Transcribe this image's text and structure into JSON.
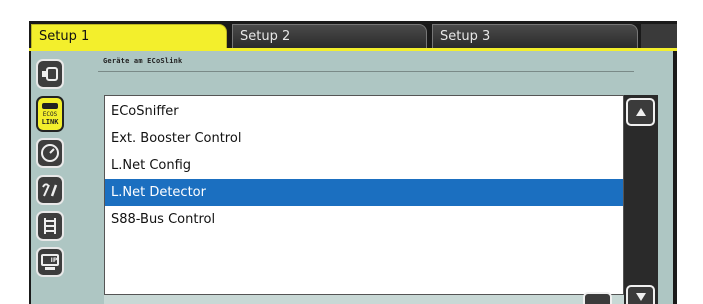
{
  "tabs": [
    {
      "label": "Setup 1",
      "active": true
    },
    {
      "label": "Setup 2",
      "active": false
    },
    {
      "label": "Setup 3",
      "active": false
    }
  ],
  "section_heading": "Geräte am ECoSlink",
  "sidebar": {
    "items": [
      {
        "icon": "locomotive-connector-icon",
        "label": ""
      },
      {
        "icon": "ecoslink-icon",
        "label": "LINK",
        "active": true
      },
      {
        "icon": "gauge-icon",
        "label": ""
      },
      {
        "icon": "wrench-tools-icon",
        "label": ""
      },
      {
        "icon": "track-ladder-icon",
        "label": ""
      },
      {
        "icon": "ip-network-icon",
        "label": "IP"
      }
    ]
  },
  "device_list": {
    "items": [
      {
        "label": "ECoSniffer",
        "selected": false
      },
      {
        "label": "Ext. Booster Control",
        "selected": false
      },
      {
        "label": "L.Net Config",
        "selected": false
      },
      {
        "label": "L.Net Detector",
        "selected": true
      },
      {
        "label": "S88-Bus Control",
        "selected": false
      }
    ]
  },
  "colors": {
    "active_tab": "#f3ef2c",
    "panel": "#aec6c3",
    "selection": "#1b6fc0",
    "frame": "#1a1a1a"
  }
}
